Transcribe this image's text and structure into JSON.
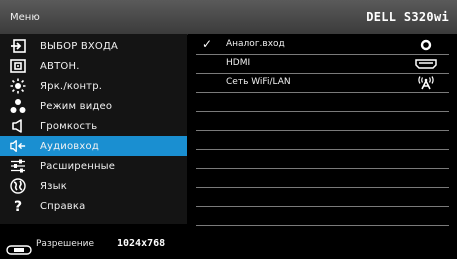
{
  "header": {
    "menu_title": "Меню",
    "model": "DELL S320wi"
  },
  "menu": {
    "items": [
      {
        "label": "ВЫБОР ВХОДА",
        "icon": "input-select-icon",
        "selected": false
      },
      {
        "label": "АВТОН.",
        "icon": "auto-adjust-icon",
        "selected": false
      },
      {
        "label": "Ярк./контр.",
        "icon": "brightness-icon",
        "selected": false
      },
      {
        "label": "Режим видео",
        "icon": "video-mode-icon",
        "selected": false
      },
      {
        "label": "Громкость",
        "icon": "volume-icon",
        "selected": false
      },
      {
        "label": "Аудиовход",
        "icon": "audio-input-icon",
        "selected": true
      },
      {
        "label": "Расширенные",
        "icon": "advanced-settings-icon",
        "selected": false
      },
      {
        "label": "Язык",
        "icon": "language-icon",
        "selected": false
      },
      {
        "label": "Справка",
        "icon": "help-icon",
        "selected": false
      }
    ]
  },
  "audio_input": {
    "options": [
      {
        "label": "Аналог.вход",
        "checked": true,
        "icon": "analog-jack-icon"
      },
      {
        "label": "HDMI",
        "checked": false,
        "icon": "hdmi-port-icon"
      },
      {
        "label": "Сеть  WiFi/LAN",
        "checked": false,
        "icon": "wireless-antenna-icon"
      }
    ],
    "check_mark": "✓"
  },
  "footer": {
    "label": "Разрешение",
    "value": "1024x768",
    "icon": "display-resolution-icon"
  },
  "colors": {
    "selected": "#1a8fd1",
    "titlebar": "#4a4a4a"
  }
}
